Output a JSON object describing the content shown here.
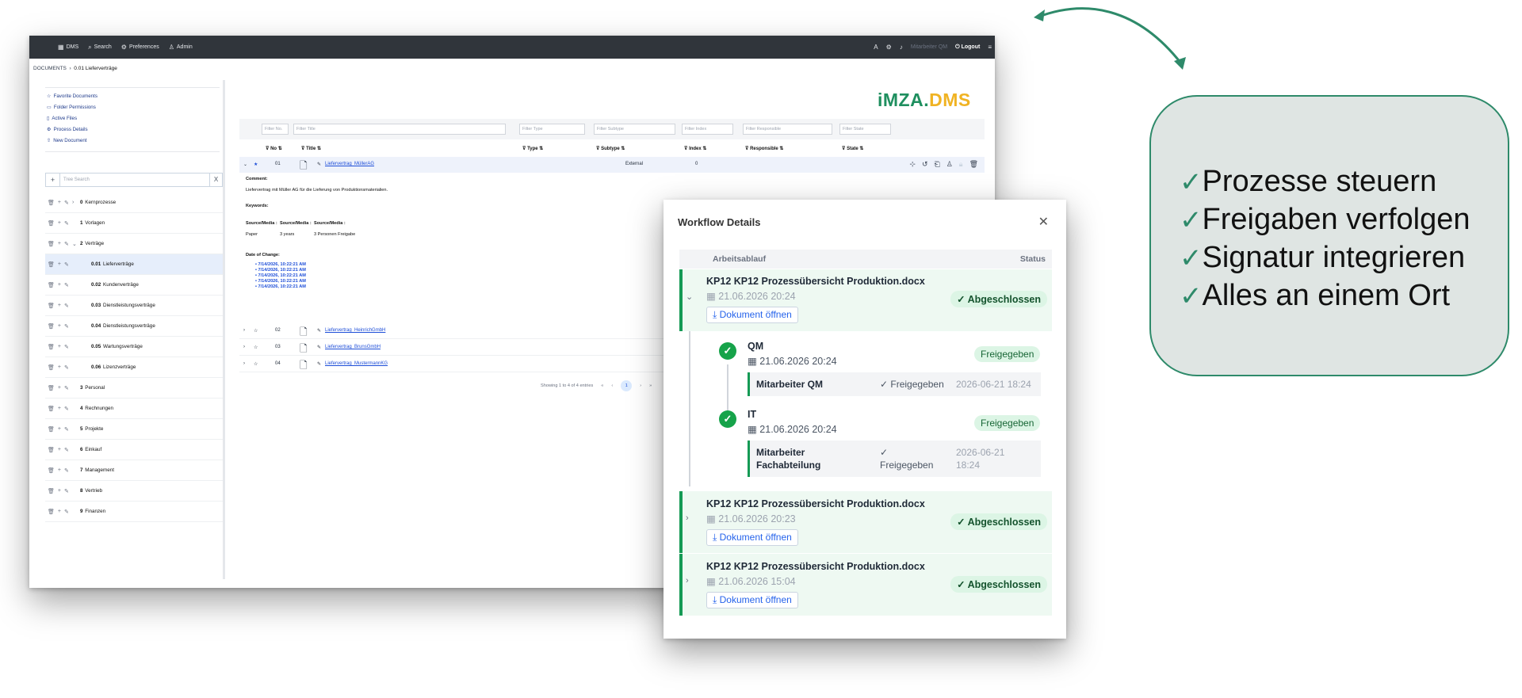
{
  "topbar": {
    "nav": [
      "DMS",
      "Search",
      "Preferences",
      "Admin"
    ],
    "user": "Mitarbeiter QM",
    "logout": "Logout"
  },
  "breadcrumb": {
    "root": "DOCUMENTS",
    "current": "0.01 Lieferverträge"
  },
  "quick_links": [
    "Favorite Documents",
    "Folder Permissions",
    "Active Files",
    "Process Details",
    "New Document"
  ],
  "tree_search": {
    "placeholder": "Tree Search",
    "clear": "X"
  },
  "tree": [
    {
      "num": "0",
      "label": "Kernprozesse"
    },
    {
      "num": "1",
      "label": "Vorlagen"
    },
    {
      "num": "2",
      "label": "Verträge"
    },
    {
      "num": "0.01",
      "label": "Lieferverträge"
    },
    {
      "num": "0.02",
      "label": "Kundenverträge"
    },
    {
      "num": "0.03",
      "label": "Dienstleistungsverträge"
    },
    {
      "num": "0.04",
      "label": "Dienstleistungsverträge"
    },
    {
      "num": "0.05",
      "label": "Wartungsverträge"
    },
    {
      "num": "0.06",
      "label": "Lizenzverträge"
    },
    {
      "num": "3",
      "label": "Personal"
    },
    {
      "num": "4",
      "label": "Rechnungen"
    },
    {
      "num": "5",
      "label": "Projekte"
    },
    {
      "num": "6",
      "label": "Einkauf"
    },
    {
      "num": "7",
      "label": "Management"
    },
    {
      "num": "8",
      "label": "Vertrieb"
    },
    {
      "num": "9",
      "label": "Finanzen"
    }
  ],
  "logo": {
    "part1": "iMZA.",
    "part2": "DMS",
    "color1": "#1f8f5f",
    "color2": "#f0b323"
  },
  "filters": [
    "Filter No.",
    "Filter Title",
    "Filter Type",
    "Filter Subtype",
    "Filter Index",
    "Filter Responsible",
    "Filter State"
  ],
  "columns": [
    "No",
    "Title",
    "Type",
    "Subtype",
    "Index",
    "Responsible",
    "State"
  ],
  "documents": [
    {
      "no": "01",
      "title": "Liefervertrag_MüllerAG",
      "subtype": "External",
      "index": "0"
    },
    {
      "no": "02",
      "title": "Liefervertrag_HeinrichGmbH"
    },
    {
      "no": "03",
      "title": "Liefervertrag_BrunsGmbH"
    },
    {
      "no": "04",
      "title": "Liefervertrag_MustermannKG"
    }
  ],
  "detail": {
    "comment_label": "Comment:",
    "comment": "Liefervertrag mit Müller AG für die Lieferung von Produktionsmaterialien.",
    "keywords_label": "Keywords:",
    "source_labels": [
      "Source/Media :",
      "Source/Media :",
      "Source/Media :"
    ],
    "source_values": [
      "Paper",
      "3 years",
      "3 Personen Freigabe"
    ],
    "date_label": "Date of Change:",
    "dates": [
      "7/14/2026, 10:22:21 AM",
      "7/14/2026, 10:22:21 AM",
      "7/14/2026, 10:22:21 AM",
      "7/14/2026, 10:22:21 AM",
      "7/14/2026, 10:22:21 AM"
    ]
  },
  "paging": {
    "text": "Showing 1 to 4 of 4 entries",
    "page": "1"
  },
  "workflow": {
    "title": "Workflow Details",
    "col_process": "Arbeitsablauf",
    "col_status": "Status",
    "entries": [
      {
        "file": "KP12 KP12 Prozessübersicht Produktion.docx",
        "date": "21.06.2026 20:24",
        "button": "Dokument öffnen",
        "status": "Abgeschlossen"
      },
      {
        "file": "KP12 KP12 Prozessübersicht Produktion.docx",
        "date": "21.06.2026 20:23",
        "button": "Dokument öffnen",
        "status": "Abgeschlossen"
      },
      {
        "file": "KP12 KP12 Prozessübersicht Produktion.docx",
        "date": "21.06.2026 15:04",
        "button": "Dokument öffnen",
        "status": "Abgeschlossen"
      }
    ],
    "steps": [
      {
        "name": "QM",
        "date": "21.06.2026 20:24",
        "status": "Freigegeben",
        "person": "Mitarbeiter QM",
        "person_status": "✓ Freigegeben",
        "person_date": "2026-06-21 18:24"
      },
      {
        "name": "IT",
        "date": "21.06.2026 20:24",
        "status": "Freigegeben",
        "person1": "Mitarbeiter",
        "person2": "Fachabteilung",
        "person_status1": "✓",
        "person_status2": "Freigegeben",
        "person_date1": "2026-06-21",
        "person_date2": "18:24"
      }
    ]
  },
  "features": [
    "Prozesse steuern",
    "Freigaben verfolgen",
    "Signatur integrieren",
    "Alles an einem Ort"
  ],
  "accent_color": "#2e8a6a"
}
